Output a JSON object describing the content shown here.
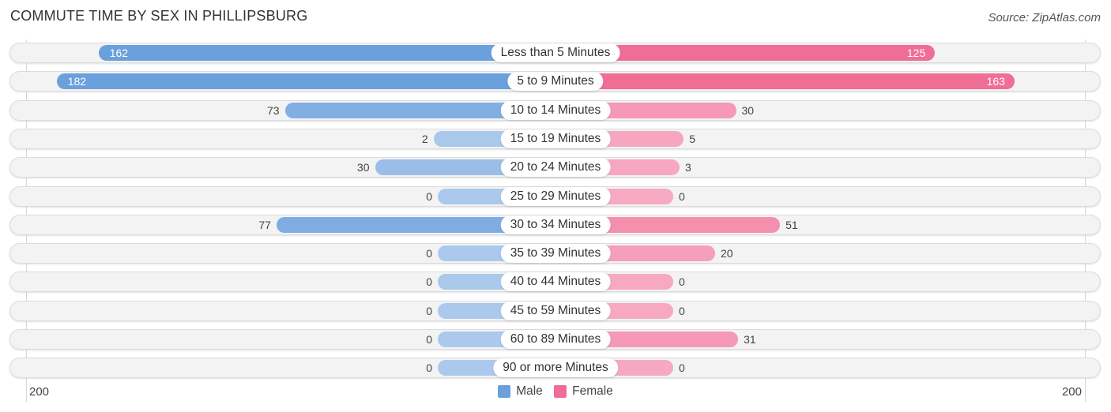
{
  "header": {
    "title": "COMMUTE TIME BY SEX IN PHILLIPSBURG",
    "source": "Source: ZipAtlas.com"
  },
  "chart_data": {
    "type": "bar",
    "orientation": "horizontal-diverging",
    "title": "COMMUTE TIME BY SEX IN PHILLIPSBURG",
    "categories": [
      "Less than 5 Minutes",
      "5 to 9 Minutes",
      "10 to 14 Minutes",
      "15 to 19 Minutes",
      "20 to 24 Minutes",
      "25 to 29 Minutes",
      "30 to 34 Minutes",
      "35 to 39 Minutes",
      "40 to 44 Minutes",
      "45 to 59 Minutes",
      "60 to 89 Minutes",
      "90 or more Minutes"
    ],
    "series": [
      {
        "name": "Male",
        "color": "#6aa0dc",
        "values": [
          162,
          182,
          73,
          2,
          30,
          0,
          77,
          0,
          0,
          0,
          0,
          0
        ]
      },
      {
        "name": "Female",
        "color": "#f06e96",
        "values": [
          125,
          163,
          30,
          5,
          3,
          0,
          51,
          20,
          0,
          0,
          31,
          0
        ]
      }
    ],
    "axis": {
      "left_label": "200",
      "right_label": "200",
      "range": [
        0,
        200
      ]
    },
    "legend": {
      "position": "bottom-center",
      "items": [
        "Male",
        "Female"
      ]
    }
  },
  "colors": {
    "male_strong": "#6aa0dc",
    "male_light": "#abc9ec",
    "female_strong": "#f06e96",
    "female_light": "#f7a9c2"
  }
}
